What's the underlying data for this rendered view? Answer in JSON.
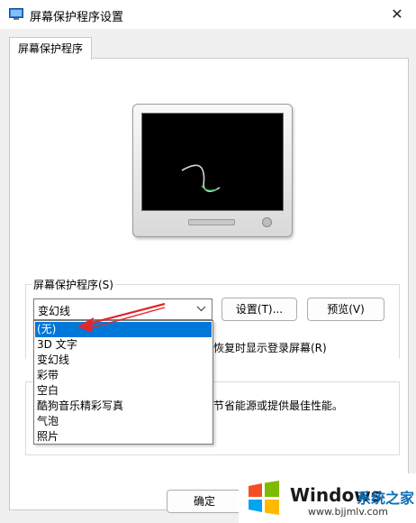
{
  "window": {
    "title": "屏幕保护程序设置",
    "close_glyph": "✕"
  },
  "tabs": [
    {
      "label": "屏幕保护程序"
    }
  ],
  "screensaver": {
    "group_label": "屏幕保护程序(S)",
    "selected": "变幻线",
    "settings_button": "设置(T)...",
    "preview_button": "预览(V)",
    "options": [
      "(无)",
      "3D 文字",
      "变幻线",
      "彩带",
      "空白",
      "酷狗音乐精彩写真",
      "气泡",
      "照片"
    ],
    "highlighted_index": 0
  },
  "partial_texts": {
    "resume_tail": "恢复时显示登录屏幕(R)",
    "power_tail": "节省能源或提供最佳性能。"
  },
  "footer": {
    "ok_button": "确定"
  },
  "watermark": {
    "brand": "Windows",
    "site": "系统之家",
    "url": "www.bjjmlv.com"
  },
  "colors": {
    "selection": "#0078d7",
    "arrow": "#e0282e"
  }
}
